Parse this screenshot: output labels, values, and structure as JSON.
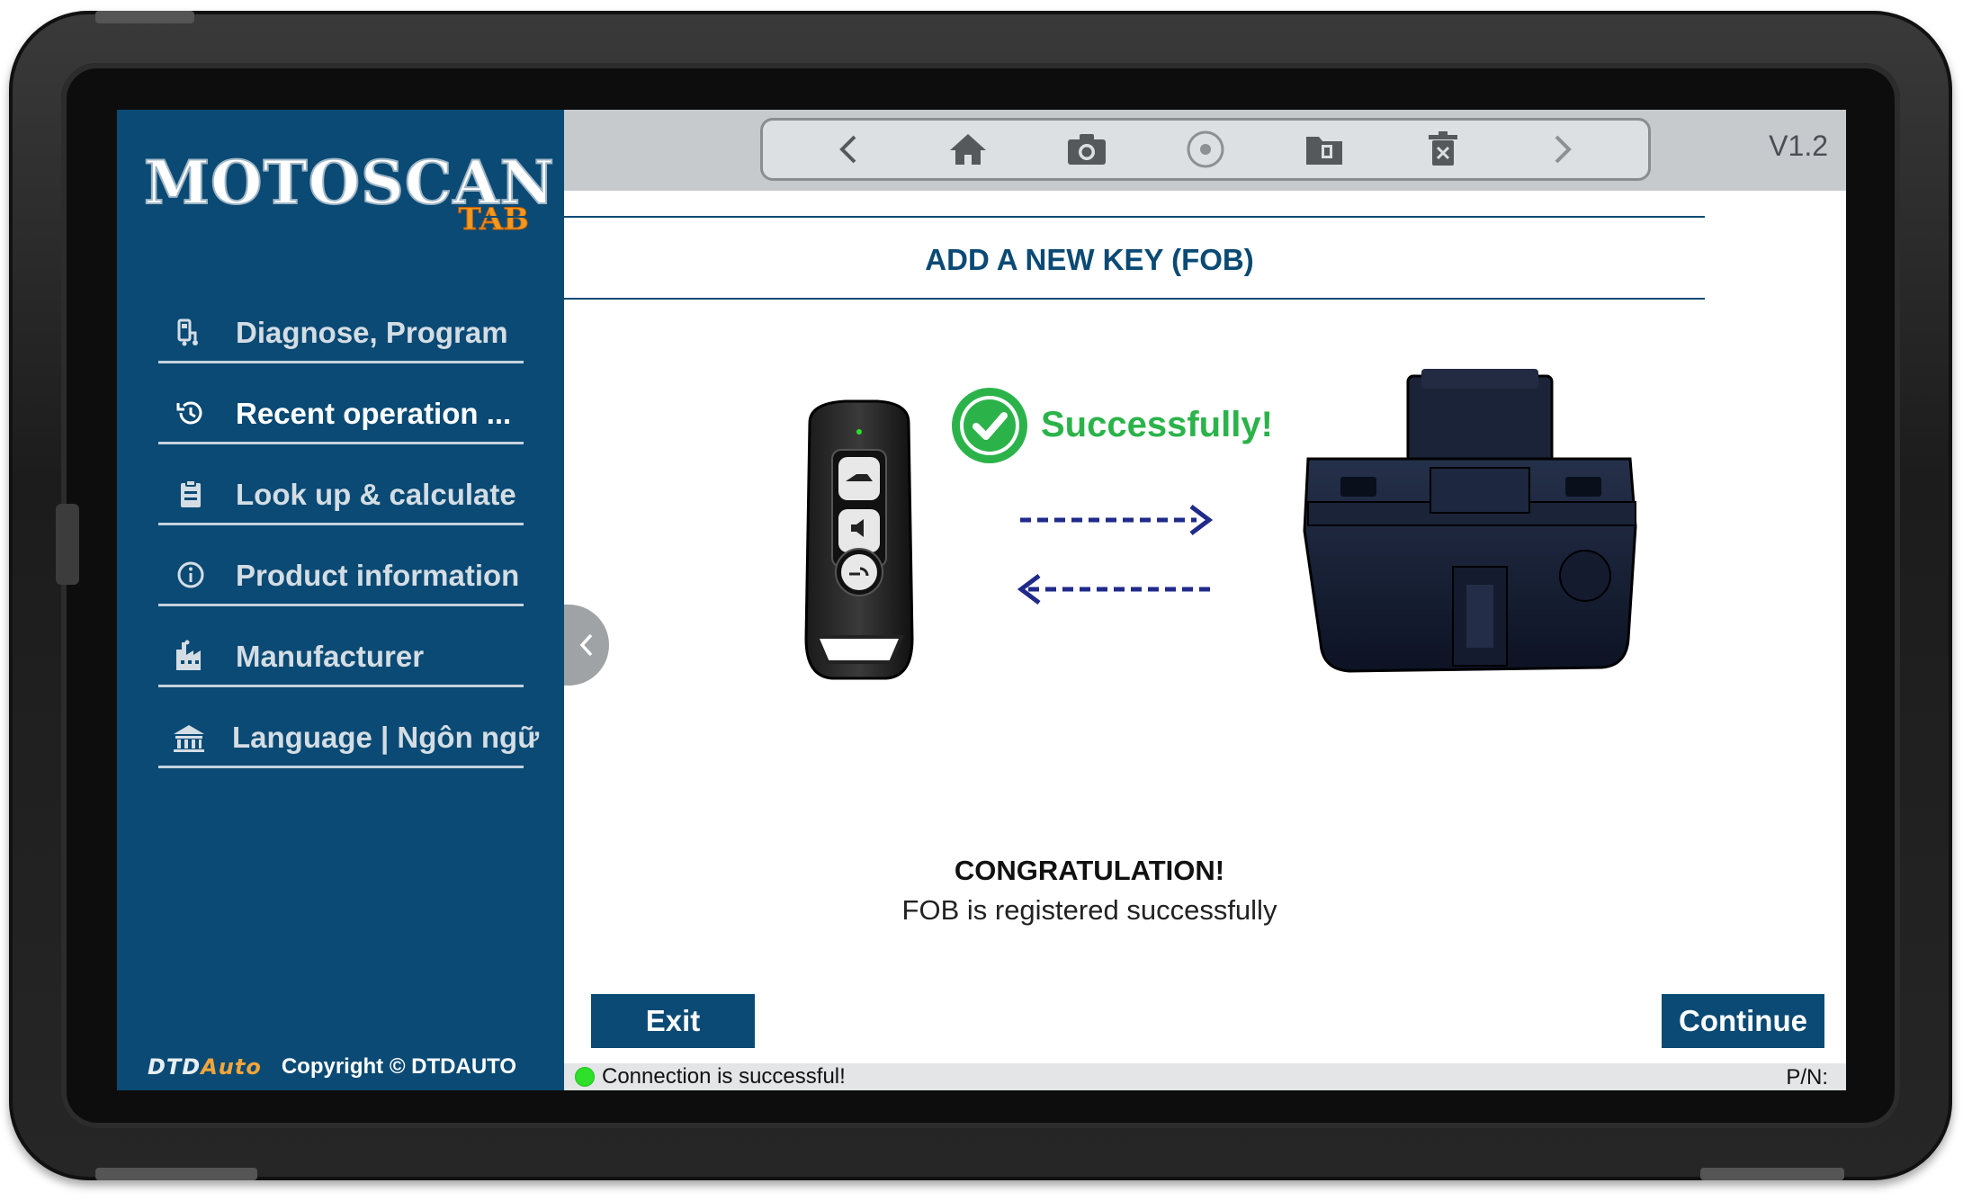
{
  "app": {
    "logo_main": "MOTOSCAN",
    "logo_sub": "TAB",
    "version": "V1.2"
  },
  "sidebar": {
    "items": [
      {
        "label": "Diagnose, Program",
        "icon": "diagnose-icon"
      },
      {
        "label": "Recent operation ...",
        "icon": "history-icon",
        "active": true
      },
      {
        "label": "Look up & calculate",
        "icon": "clipboard-icon"
      },
      {
        "label": "Product information",
        "icon": "info-icon"
      },
      {
        "label": "Manufacturer",
        "icon": "factory-icon"
      },
      {
        "label": "Language | Ngôn ngữ",
        "icon": "language-icon"
      }
    ],
    "footer_brand_1": "DTD",
    "footer_brand_2": "Auto",
    "copyright": "Copyright © DTDAUTO"
  },
  "toolbar": {
    "icons": [
      "back-icon",
      "home-icon",
      "camera-icon",
      "record-icon",
      "folder-icon",
      "delete-icon",
      "forward-icon"
    ]
  },
  "main": {
    "title": "ADD A NEW KEY (FOB)",
    "success_label": "Successfully!",
    "congrats_title": "CONGRATULATION!",
    "congrats_message": "FOB is registered successfully",
    "exit_label": "Exit",
    "continue_label": "Continue"
  },
  "status": {
    "connection": "Connection is successful!",
    "pn_label": "P/N:"
  },
  "colors": {
    "sidebar_bg": "#0a4a74",
    "accent": "#0a4a74",
    "success_green": "#2bb34a",
    "status_dot": "#2ee02a",
    "logo_orange": "#f29a1f",
    "arrow_navy": "#1f2a8a"
  }
}
